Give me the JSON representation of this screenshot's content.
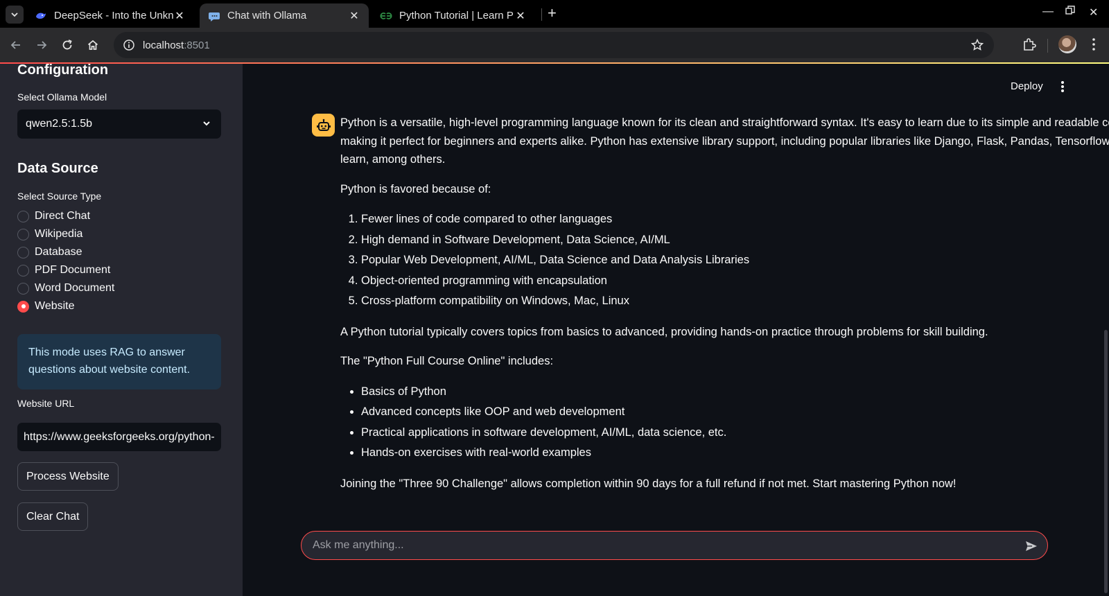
{
  "browser": {
    "tabs": [
      {
        "title": "DeepSeek - Into the Unkn",
        "icon": "deepseek-whale-icon",
        "active": false
      },
      {
        "title": "Chat with Ollama",
        "icon": "speech-bubble-icon",
        "active": true
      },
      {
        "title": "Python Tutorial | Learn P",
        "icon": "geeksforgeeks-icon",
        "active": false
      }
    ],
    "url_host": "localhost",
    "url_port": ":8501"
  },
  "sidebar": {
    "config_heading": "Configuration",
    "model_label": "Select Ollama Model",
    "model_value": "qwen2.5:1.5b",
    "data_source_heading": "Data Source",
    "source_type_label": "Select Source Type",
    "source_options": [
      "Direct Chat",
      "Wikipedia",
      "Database",
      "PDF Document",
      "Word Document",
      "Website"
    ],
    "selected_source": "Website",
    "info_text": "This mode uses RAG to answer questions about website content.",
    "url_label": "Website URL",
    "url_value": "https://www.geeksforgeeks.org/python-programming-language-tutorial/",
    "process_button": "Process Website",
    "clear_button": "Clear Chat"
  },
  "header": {
    "deploy_label": "Deploy"
  },
  "message": {
    "p1": "Python is a versatile, high-level programming language known for its clean and straightforward syntax. It's easy to learn due to its simple and readable code, making it perfect for beginners and experts alike. Python has extensive library support, including popular libraries like Django, Flask, Pandas, Tensorflow, Scikit-learn, among others.",
    "p2": "Python is favored because of:",
    "ordered": [
      "Fewer lines of code compared to other languages",
      "High demand in Software Development, Data Science, AI/ML",
      "Popular Web Development, AI/ML, Data Science and Data Analysis Libraries",
      "Object-oriented programming with encapsulation",
      "Cross-platform compatibility on Windows, Mac, Linux"
    ],
    "p3": "A Python tutorial typically covers topics from basics to advanced, providing hands-on practice through problems for skill building.",
    "p4": "The \"Python Full Course Online\" includes:",
    "bullets": [
      "Basics of Python",
      "Advanced concepts like OOP and web development",
      "Practical applications in software development, AI/ML, data science, etc.",
      "Hands-on exercises with real-world examples"
    ],
    "p5": "Joining the \"Three 90 Challenge\" allows completion within 90 days for a full refund if not met. Start mastering Python now!"
  },
  "chat_input": {
    "placeholder": "Ask me anything..."
  },
  "colors": {
    "accent": "#ff4b4b",
    "sidebar_bg": "#262730",
    "main_bg": "#0e1117",
    "info_bg": "#1e3448",
    "avatar_bg": "#ffbd45"
  }
}
